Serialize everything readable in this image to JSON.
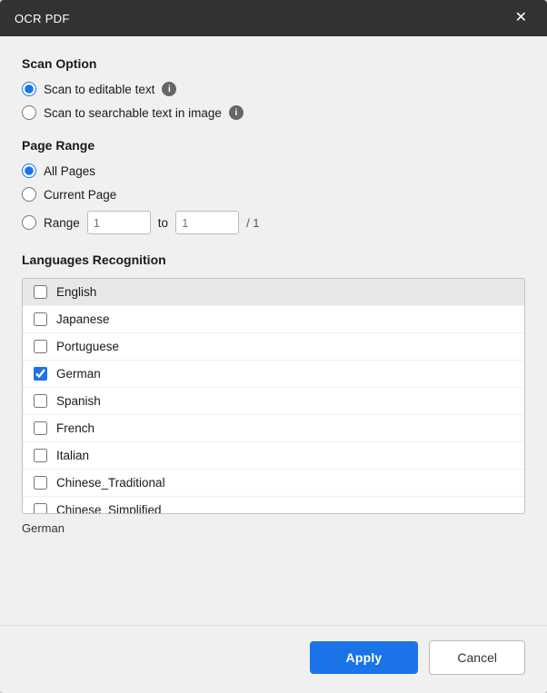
{
  "dialog": {
    "title": "OCR PDF",
    "close_label": "✕"
  },
  "scan_option": {
    "section_title": "Scan Option",
    "options": [
      {
        "id": "scan-editable",
        "label": "Scan to editable text",
        "has_info": true,
        "checked": true
      },
      {
        "id": "scan-searchable",
        "label": "Scan to searchable text in image",
        "has_info": true,
        "checked": false
      }
    ]
  },
  "page_range": {
    "section_title": "Page Range",
    "options": [
      {
        "id": "all-pages",
        "label": "All Pages",
        "checked": true
      },
      {
        "id": "current-page",
        "label": "Current Page",
        "checked": false
      },
      {
        "id": "range",
        "label": "Range",
        "checked": false
      }
    ],
    "range_from_placeholder": "1",
    "range_to_placeholder": "1",
    "range_separator": "to",
    "range_total": "/ 1"
  },
  "languages": {
    "section_title": "Languages Recognition",
    "items": [
      {
        "name": "English",
        "checked": false,
        "highlighted": true
      },
      {
        "name": "Japanese",
        "checked": false,
        "highlighted": false
      },
      {
        "name": "Portuguese",
        "checked": false,
        "highlighted": false
      },
      {
        "name": "German",
        "checked": true,
        "highlighted": false
      },
      {
        "name": "Spanish",
        "checked": false,
        "highlighted": false
      },
      {
        "name": "French",
        "checked": false,
        "highlighted": false
      },
      {
        "name": "Italian",
        "checked": false,
        "highlighted": false
      },
      {
        "name": "Chinese_Traditional",
        "checked": false,
        "highlighted": false
      },
      {
        "name": "Chinese_Simplified",
        "checked": false,
        "highlighted": false
      }
    ],
    "selected_label": "German"
  },
  "footer": {
    "apply_label": "Apply",
    "cancel_label": "Cancel"
  }
}
